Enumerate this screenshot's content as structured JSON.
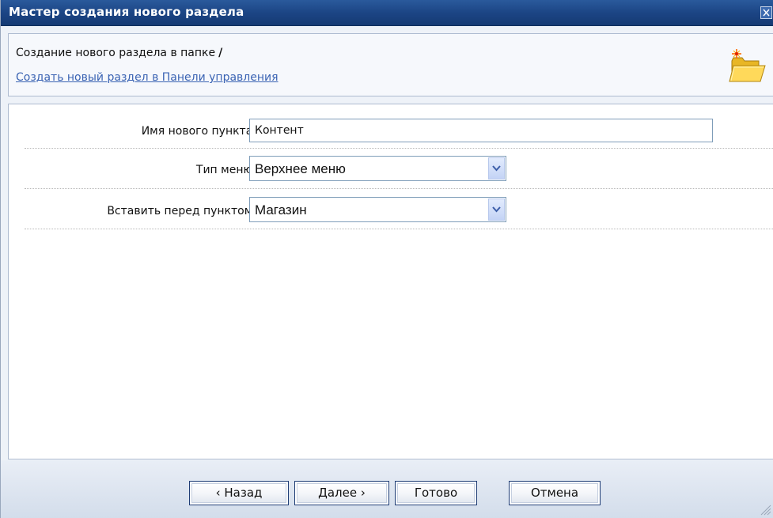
{
  "window": {
    "title": "Мастер создания нового раздела"
  },
  "header": {
    "title": "Создание нового раздела в папке",
    "path": "/",
    "link": "Создать новый раздел в Панели управления"
  },
  "form": {
    "name_label": "Имя нового пункта:",
    "name_value": "Контент",
    "menu_type_label": "Тип меню:",
    "menu_type_value": "Верхнее меню",
    "insert_before_label": "Вставить перед пунктом:",
    "insert_before_value": "Магазин"
  },
  "buttons": {
    "back": "‹ Назад",
    "next": "Далее ›",
    "done": "Готово",
    "cancel": "Отмена"
  },
  "icons": {
    "close": "close-icon",
    "folder": "new-folder-icon",
    "dropdown": "chevron-down-icon",
    "grip": "resize-grip-icon"
  },
  "colors": {
    "titlebar": "#1c4585",
    "link": "#3a63b3",
    "panel_border": "#aebbd0",
    "footer": "#d3ddeb"
  }
}
